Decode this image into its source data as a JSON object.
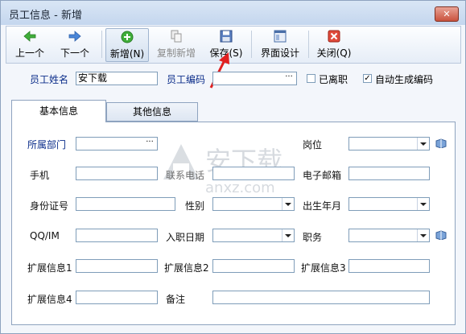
{
  "window": {
    "title": "员工信息 - 新增"
  },
  "toolbar": {
    "prev": "上一个",
    "next": "下一个",
    "add": "新增(N)",
    "copy_add": "复制新增",
    "save": "保存(S)",
    "design": "界面设计",
    "close": "关闭(Q)"
  },
  "header": {
    "name_label": "员工姓名",
    "name_value": "安下载",
    "code_label": "员工编码",
    "code_value": "",
    "resigned_label": "已离职",
    "resigned_checked": false,
    "auto_code_label": "自动生成编码",
    "auto_code_checked": true
  },
  "tabs": [
    "基本信息",
    "其他信息"
  ],
  "form": {
    "dept_label": "所属部门",
    "post_label": "岗位",
    "mobile_label": "手机",
    "phone_label": "联系电话",
    "email_label": "电子邮箱",
    "idcard_label": "身份证号",
    "gender_label": "性别",
    "birth_label": "出生年月",
    "qq_label": "QQ/IM",
    "join_label": "入职日期",
    "job_label": "职务",
    "ext1_label": "扩展信息1",
    "ext2_label": "扩展信息2",
    "ext3_label": "扩展信息3",
    "ext4_label": "扩展信息4",
    "remark_label": "备注"
  },
  "watermark": {
    "main": "安下载",
    "sub": "anxz.com"
  },
  "colors": {
    "label_blue": "#0b2d8a",
    "arrow_red": "#e02020",
    "titlebar": "#c4d6ee"
  }
}
